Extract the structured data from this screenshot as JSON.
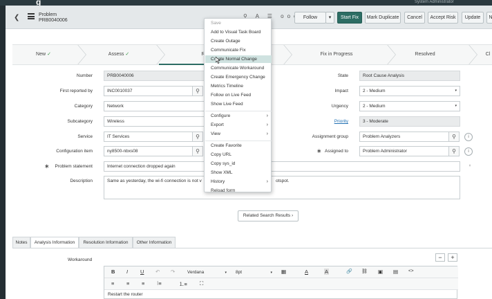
{
  "top": {
    "logo": "g",
    "user": "System Administrator"
  },
  "header": {
    "record_type": "Problem",
    "record_number": "PRB0040006",
    "icons": "⚲ A ☰ ooo",
    "buttons": {
      "follow": "Follow",
      "follow_caret": "▾",
      "start_fix": "Start Fix",
      "mark_duplicate": "Mark Duplicate",
      "cancel": "Cancel",
      "accept_risk": "Accept Risk",
      "update": "Update",
      "overflow": "N"
    }
  },
  "flow": {
    "steps": [
      "New",
      "Assess",
      "Ro",
      "Fix in Progress",
      "Resolved",
      "Cl"
    ],
    "check": "✓"
  },
  "fields": {
    "number": {
      "label": "Number",
      "value": "PRB0040006"
    },
    "first_reported_by": {
      "label": "First reported by",
      "value": "INC0010037"
    },
    "category": {
      "label": "Category",
      "value": "Network"
    },
    "subcategory": {
      "label": "Subcategory",
      "value": "Wireless"
    },
    "service": {
      "label": "Service",
      "value": "IT Services"
    },
    "configuration_item": {
      "label": "Configuration item",
      "value": "ny8500-nbxs08"
    },
    "problem_statement": {
      "label": "Problem statement",
      "value": "Internet connection dropped again"
    },
    "description": {
      "label": "Description",
      "value": "Same as yesterday,  the wi-fi connection is not v",
      "value_tail": "otspot."
    },
    "state": {
      "label": "State",
      "value": "Root Cause Analysis"
    },
    "impact": {
      "label": "Impact",
      "value": "2 - Medium"
    },
    "urgency": {
      "label": "Urgency",
      "value": "2 - Medium"
    },
    "priority": {
      "label": "Priority",
      "value": "3 - Moderate"
    },
    "assignment_group": {
      "label": "Assignment group",
      "value": "Problem Analyzers"
    },
    "assigned_to": {
      "label": "Assigned to",
      "value": "Problem Administrator"
    }
  },
  "glyphs": {
    "search": "⚲",
    "info": "i",
    "bulb": "♀",
    "caret": "▾",
    "required": "∗",
    "chevron_right": "›"
  },
  "related": {
    "label": "Related Search Results",
    "chevron": "›"
  },
  "tabs": [
    "Notes",
    "Analysis Information",
    "Resolution Information",
    "Other Information"
  ],
  "workaround": {
    "label": "Workaround",
    "minus": "−",
    "plus": "+",
    "font": "Verdana",
    "size": "8pt",
    "content": "Restart the router"
  },
  "editor_icons": {
    "bold": "B",
    "italic": "I",
    "underline": "U",
    "undo": "↶",
    "redo": "↷",
    "table": "▦",
    "font_color": "A",
    "bg_color": "A",
    "link": "🔗",
    "unlink": "⛓",
    "image": "▣",
    "media": "▤",
    "code": "<>",
    "align_left": "≡",
    "align_center": "≡",
    "align_right": "≡",
    "bullets": "⁝≡",
    "numbers": "⒈≡",
    "fullscreen": "⛶"
  },
  "context_menu": {
    "items": [
      {
        "label": "Save",
        "style": "light"
      },
      {
        "label": "Add to Visual Task Board"
      },
      {
        "label": "Create Outage"
      },
      {
        "label": "Communicate Fix"
      },
      {
        "label": "Create Normal Change",
        "style": "highlight"
      },
      {
        "label": "Communicate Workaround"
      },
      {
        "label": "Create Emergency Change"
      },
      {
        "label": "Metrics Timeline"
      },
      {
        "label": "Follow on Live Feed"
      },
      {
        "label": "Show Live Feed"
      },
      {
        "label": "Configure",
        "submenu": true
      },
      {
        "label": "Export",
        "submenu": true
      },
      {
        "label": "View",
        "submenu": true
      },
      {
        "label": "Create Favorite"
      },
      {
        "label": "Copy URL"
      },
      {
        "label": "Copy sys_id"
      },
      {
        "label": "Show XML"
      },
      {
        "label": "History",
        "submenu": true
      },
      {
        "label": "Reload form"
      }
    ]
  },
  "colors": {
    "accent": "#2d6d64",
    "highlight": "#cfe2e0",
    "link": "#1f6fb2",
    "check": "#3a9a48"
  }
}
